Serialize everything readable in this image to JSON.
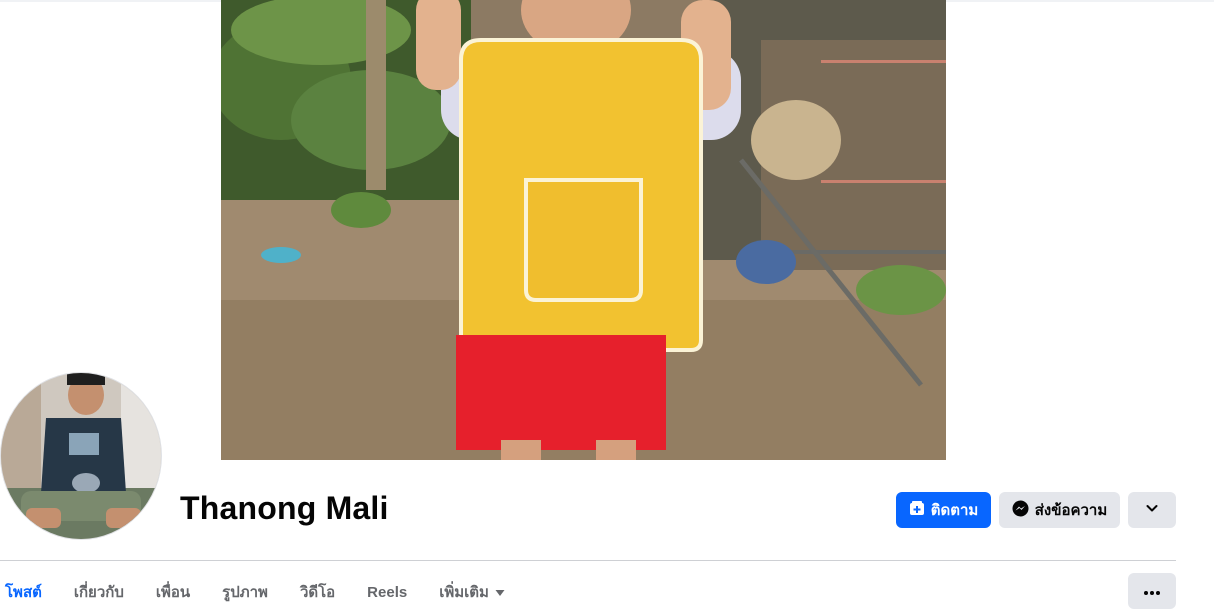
{
  "profile": {
    "name": "Thanong Mali"
  },
  "actions": {
    "follow_label": "ติดตาม",
    "message_label": "ส่งข้อความ"
  },
  "tabs": [
    {
      "label": "โพสต์",
      "active": true
    },
    {
      "label": "เกี่ยวกับ"
    },
    {
      "label": "เพื่อน"
    },
    {
      "label": "รูปภาพ"
    },
    {
      "label": "วิดีโอ"
    },
    {
      "label": "Reels"
    },
    {
      "label": "เพิ่มเติม"
    }
  ],
  "colors": {
    "accent": "#0866ff",
    "button_gray": "#e4e6eb",
    "text_secondary": "#65676b"
  },
  "icons": {
    "follow": "follow-add-icon",
    "message": "messenger-icon",
    "dropdown": "chevron-down-icon",
    "more": "ellipsis-icon"
  }
}
